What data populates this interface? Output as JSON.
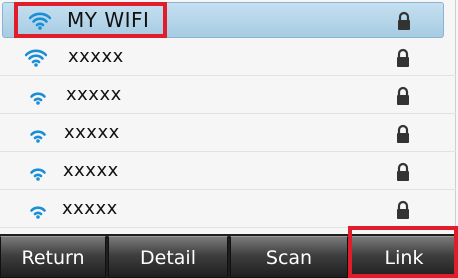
{
  "networks": [
    {
      "ssid": "MY WIFI",
      "secured": true,
      "selected": true,
      "icon": "wifi-icon"
    },
    {
      "ssid": "xxxxx",
      "secured": true,
      "selected": false,
      "icon": "wifi-icon"
    },
    {
      "ssid": "xxxxx",
      "secured": true,
      "selected": false,
      "icon": "wifi-icon"
    },
    {
      "ssid": "xxxxx",
      "secured": true,
      "selected": false,
      "icon": "wifi-icon"
    },
    {
      "ssid": "xxxxx",
      "secured": true,
      "selected": false,
      "icon": "wifi-icon"
    },
    {
      "ssid": "xxxxx",
      "secured": true,
      "selected": false,
      "icon": "wifi-icon"
    }
  ],
  "softkeys": {
    "return_label": "Return",
    "detail_label": "Detail",
    "scan_label": "Scan",
    "link_label": "Link"
  },
  "colors": {
    "selection": "#b5d6ea",
    "wifi_icon": "#1a8fd8",
    "highlight": "#e01e2b",
    "softkey_bar": "#1e1e1e"
  }
}
